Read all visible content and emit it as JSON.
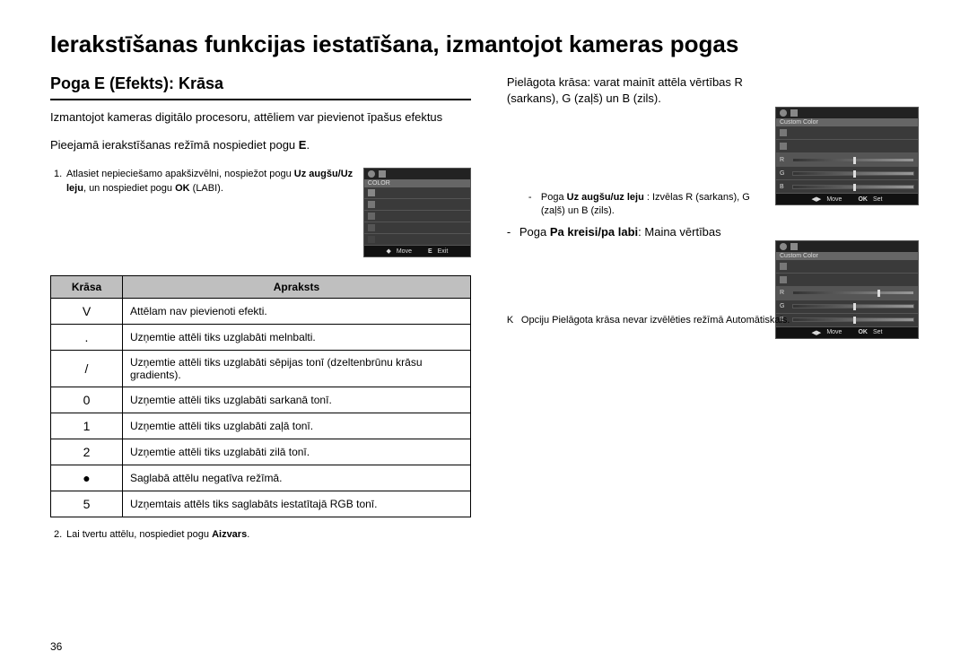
{
  "page": {
    "number": "36",
    "main_title": "Ierakstīšanas funkcijas iestatīšana, izmantojot kameras pogas"
  },
  "left": {
    "section_title": "Poga E (Efekts): Krāsa",
    "intro": "Izmantojot kameras digitālo procesoru, attēliem var pievienot īpašus efektus",
    "instruction_pre": "Pieejamā ierakstīšanas režīmā nospiediet pogu ",
    "instruction_bold": "E",
    "instruction_post": ".",
    "step1_pre": "Atlasiet nepieciešamo apakšizvēlni, nospiežot pogu ",
    "step1_b1": "Uz augšu/Uz leju",
    "step1_mid": ", un nospiediet pogu ",
    "step1_b2": "OK",
    "step1_post": " (LABI).",
    "lcd1": {
      "header": "COLOR",
      "move": "Move",
      "exit": "Exit",
      "e": "E"
    },
    "table": {
      "h1": "Krāsa",
      "h2": "Apraksts",
      "rows": [
        {
          "sym": "V",
          "desc": "Attēlam nav pievienoti efekti."
        },
        {
          "sym": ".",
          "desc": "Uzņemtie attēli tiks uzglabāti melnbalti."
        },
        {
          "sym": "/",
          "desc": "Uzņemtie attēli tiks uzglabāti sēpijas tonī (dzeltenbrūnu krāsu gradients)."
        },
        {
          "sym": "0",
          "desc": "Uzņemtie attēli tiks uzglabāti sarkanā tonī."
        },
        {
          "sym": "1",
          "desc": "Uzņemtie attēli tiks uzglabāti zaļā tonī."
        },
        {
          "sym": "2",
          "desc": "Uzņemtie attēli tiks uzglabāti zilā tonī."
        },
        {
          "sym": "●",
          "desc": "Saglabā attēlu negatīva režīmā."
        },
        {
          "sym": "5",
          "desc": "Uzņemtais attēls tiks saglabāts iestatītajā RGB tonī."
        }
      ]
    },
    "footnote_pre": "Lai tvertu attēlu, nospiediet pogu ",
    "footnote_b": "Aizvars",
    "footnote_post": "."
  },
  "right": {
    "custom_text": "Pielāgota krāsa: varat mainīt attēla vērtības R (sarkans), G (zaļš) un B (zils).",
    "lcd2a": {
      "header": "Custom Color",
      "r": "R",
      "g": "G",
      "b": "B",
      "move": "Move",
      "ok": "OK",
      "set": "Set"
    },
    "bullet1_pre": "Poga ",
    "bullet1_b": "Uz augšu/uz leju",
    "bullet1_post": " : Izvēlas R (sarkans), G (zaļš) un B (zils).",
    "bullet2_pre": "Poga ",
    "bullet2_b": "Pa kreisi/pa labi",
    "bullet2_post": ": Maina vērtības",
    "lcd2b": {
      "header": "Custom Color",
      "move": "Move",
      "ok": "OK",
      "set": "Set"
    },
    "note": "Opciju Pielāgota krāsa nevar izvēlēties režīmā Automātiskais."
  }
}
